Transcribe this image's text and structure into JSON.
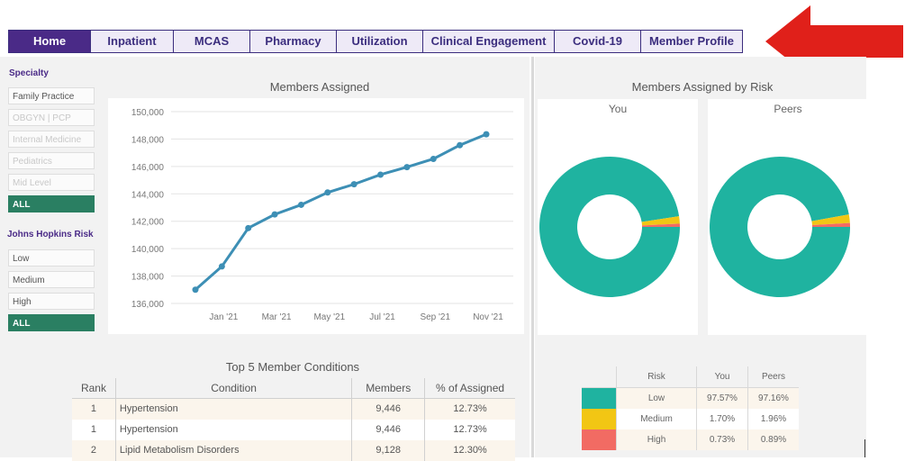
{
  "tabs": [
    {
      "label": "Home",
      "active": true
    },
    {
      "label": "Inpatient",
      "active": false
    },
    {
      "label": "MCAS",
      "active": false
    },
    {
      "label": "Pharmacy",
      "active": false
    },
    {
      "label": "Utilization",
      "active": false
    },
    {
      "label": "Clinical Engagement",
      "active": false
    },
    {
      "label": "Covid-19",
      "active": false
    },
    {
      "label": "Member Profile",
      "active": false
    }
  ],
  "filters": {
    "specialty_title": "Specialty",
    "specialty": [
      "Family Practice",
      "OBGYN | PCP",
      "Internal Medicine",
      "Pediatrics",
      "Mid Level",
      "ALL"
    ],
    "risk_title": "Johns Hopkins Risk",
    "risk": [
      "Low",
      "Medium",
      "High",
      "ALL"
    ]
  },
  "members_chart": {
    "title": "Members Assigned",
    "y_ticks": [
      "150,000",
      "148,000",
      "146,000",
      "144,000",
      "142,000",
      "140,000",
      "138,000",
      "136,000"
    ],
    "x_ticks": [
      "Jan '21",
      "Mar '21",
      "May '21",
      "Jul '21",
      "Sep '21",
      "Nov '21"
    ]
  },
  "chart_data": {
    "type": "line",
    "title": "Members Assigned",
    "x": [
      "Dec '20",
      "Jan '21",
      "Feb '21",
      "Mar '21",
      "Apr '21",
      "May '21",
      "Jun '21",
      "Jul '21",
      "Aug '21",
      "Sep '21",
      "Oct '21",
      "Nov '21"
    ],
    "values": [
      137000,
      138700,
      141500,
      142500,
      143200,
      144100,
      144700,
      145400,
      145950,
      146550,
      147550,
      148350
    ],
    "ylim": [
      136000,
      150000
    ],
    "color": "#3d8fb5"
  },
  "conditions": {
    "title": "Top 5 Member Conditions",
    "headers": [
      "Rank",
      "Condition",
      "Members",
      "% of Assigned"
    ],
    "rows": [
      [
        "1",
        "Hypertension",
        "9,446",
        "12.73%"
      ],
      [
        "1",
        "Hypertension",
        "9,446",
        "12.73%"
      ],
      [
        "2",
        "Lipid Metabolism Disorders",
        "9,128",
        "12.30%"
      ]
    ]
  },
  "risk_section": {
    "title": "Members Assigned by Risk",
    "you_label": "You",
    "peers_label": "Peers",
    "headers": [
      "Risk",
      "You",
      "Peers"
    ],
    "rows": [
      {
        "risk": "Low",
        "you": "97.57%",
        "peers": "97.16%",
        "color": "#1fb3a0"
      },
      {
        "risk": "Medium",
        "you": "1.70%",
        "peers": "1.96%",
        "color": "#f2c614"
      },
      {
        "risk": "High",
        "you": "0.73%",
        "peers": "0.89%",
        "color": "#f26b63"
      }
    ]
  },
  "colors": {
    "brand": "#4a2a87",
    "accent": "#2a7f62",
    "arrow": "#e0201a"
  }
}
